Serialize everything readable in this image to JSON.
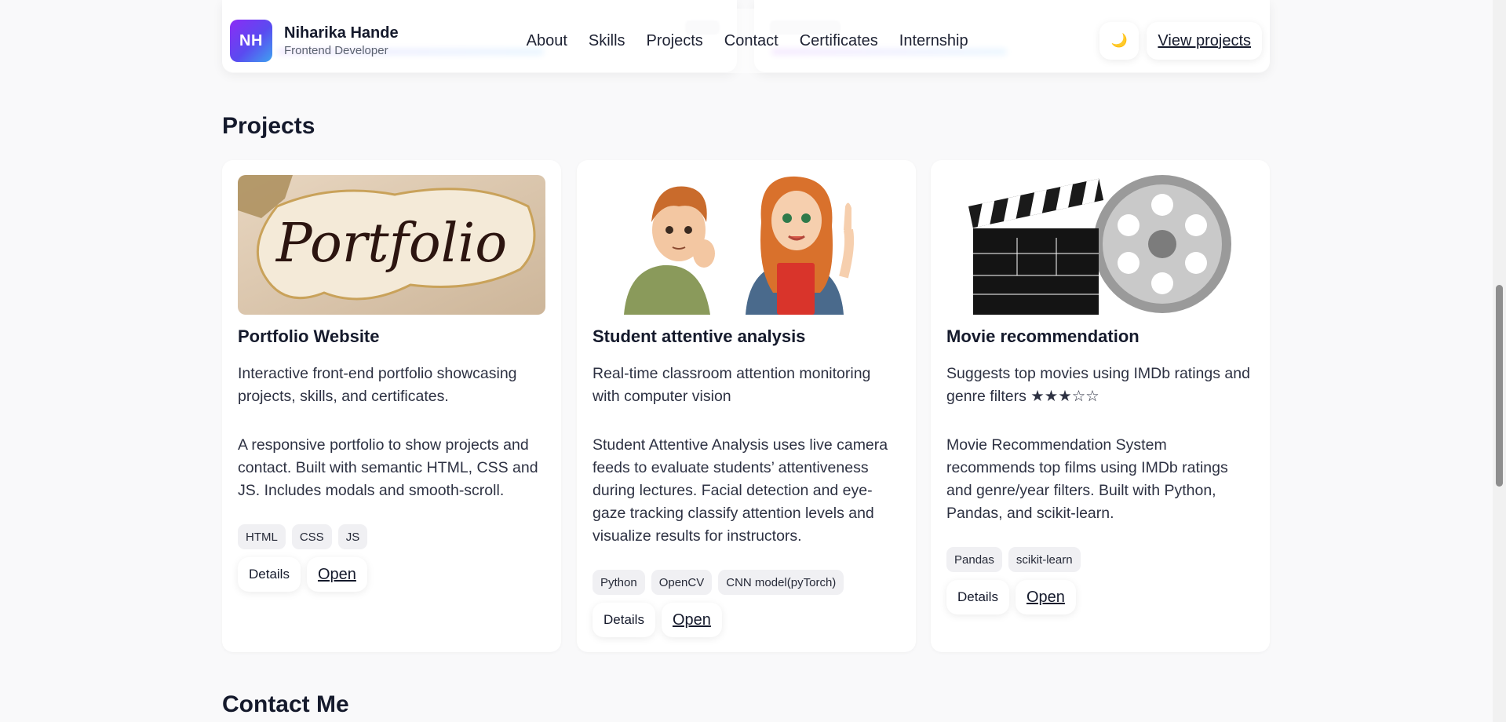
{
  "header": {
    "logo_initials": "NH",
    "name": "Niharika Hande",
    "role": "Frontend Developer",
    "nav": [
      "About",
      "Skills",
      "Projects",
      "Contact",
      "Certificates",
      "Internship"
    ],
    "theme_icon": "🌙",
    "cta_label": "View projects"
  },
  "projects_section": {
    "title": "Projects",
    "cards": [
      {
        "image_icon": "portfolio-image",
        "image_lettering": "Portfolio",
        "title": "Portfolio Website",
        "short": "Interactive front-end portfolio showcasing projects, skills, and certificates.",
        "long": "A responsive portfolio to show projects and contact. Built with semantic HTML, CSS and JS. Includes modals and smooth-scroll.",
        "tags": [
          "HTML",
          "CSS",
          "JS"
        ],
        "details_label": "Details",
        "open_label": "Open"
      },
      {
        "image_icon": "students-illustration",
        "title": "Student attentive analysis",
        "short": "Real-time classroom attention monitoring with computer vision",
        "long": "Student Attentive Analysis uses live camera feeds to evaluate students’ attentiveness during lectures. Facial detection and eye-gaze tracking classify attention levels and visualize results for instructors.",
        "tags": [
          "Python",
          "OpenCV",
          "CNN model(pyTorch)"
        ],
        "details_label": "Details",
        "open_label": "Open"
      },
      {
        "image_icon": "clapperboard-film-reel-image",
        "title": "Movie recommendation",
        "short": "Suggests top movies using IMDb ratings and genre filters ★★★☆☆",
        "long": "Movie Recommendation System recommends top films using IMDb ratings and genre/year filters. Built with Python, Pandas, and scikit-learn.",
        "tags": [
          "Pandas",
          "scikit-learn"
        ],
        "details_label": "Details",
        "open_label": "Open"
      }
    ]
  },
  "contact_section": {
    "title": "Contact Me"
  },
  "colors": {
    "background": "#f9f9fa",
    "text": "#151a2c",
    "logo_gradient_start": "#8b2cf5",
    "logo_gradient_end": "#3ea2f0"
  }
}
